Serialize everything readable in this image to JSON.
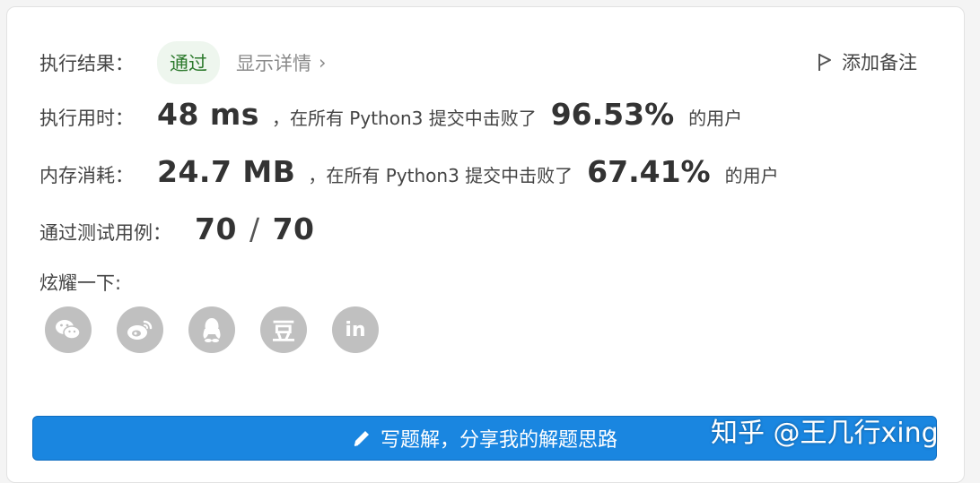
{
  "result": {
    "label": "执行结果：",
    "status": "通过",
    "details_link": "显示详情",
    "chevron": "›",
    "add_note": "添加备注"
  },
  "runtime": {
    "label": "执行用时：",
    "value": "48 ms",
    "text": "，在所有 Python3 提交中击败了",
    "percent": "96.53%",
    "suffix": "的用户"
  },
  "memory": {
    "label": "内存消耗：",
    "value": "24.7 MB",
    "text": "，在所有 Python3 提交中击败了",
    "percent": "67.41%",
    "suffix": "的用户"
  },
  "tests": {
    "label": "通过测试用例：",
    "passed": "70",
    "sep": "/",
    "total": "70"
  },
  "share": {
    "label": "炫耀一下:",
    "icons": [
      "wechat-icon",
      "weibo-icon",
      "qq-icon",
      "douban-icon",
      "linkedin-icon"
    ],
    "linkedin_text": "in",
    "douban_text": "豆"
  },
  "write_button": {
    "label": "写题解，分享我的解题思路"
  },
  "watermark": "知乎 @王几行xing",
  "colors": {
    "primary": "#1a86e0",
    "success_bg": "#eef6ee",
    "success_text": "#2d7a2d",
    "icon_grey": "#c0c0c0"
  }
}
